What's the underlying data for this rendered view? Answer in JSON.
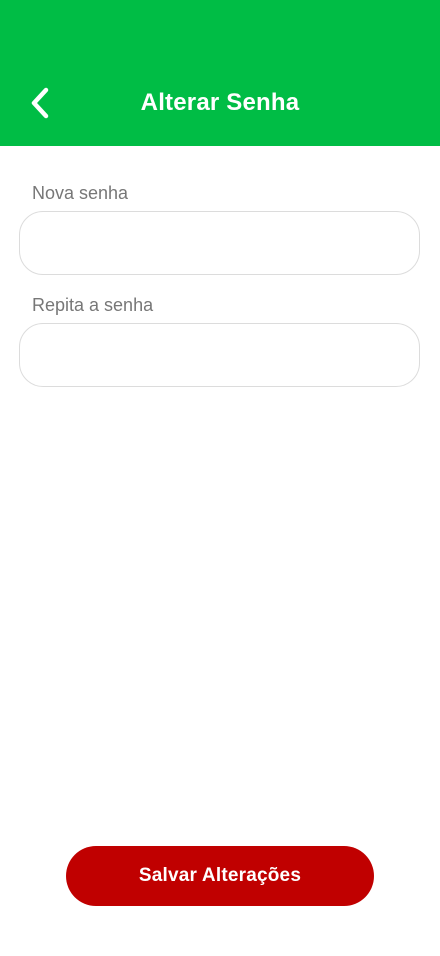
{
  "header": {
    "title": "Alterar Senha",
    "back_icon": "chevron-left-icon",
    "background_color": "#00bd45"
  },
  "form": {
    "new_password": {
      "label": "Nova senha",
      "value": "",
      "placeholder": ""
    },
    "repeat_password": {
      "label": "Repita a senha",
      "value": "",
      "placeholder": ""
    }
  },
  "actions": {
    "save_label": "Salvar Alterações",
    "save_color": "#c00000"
  }
}
